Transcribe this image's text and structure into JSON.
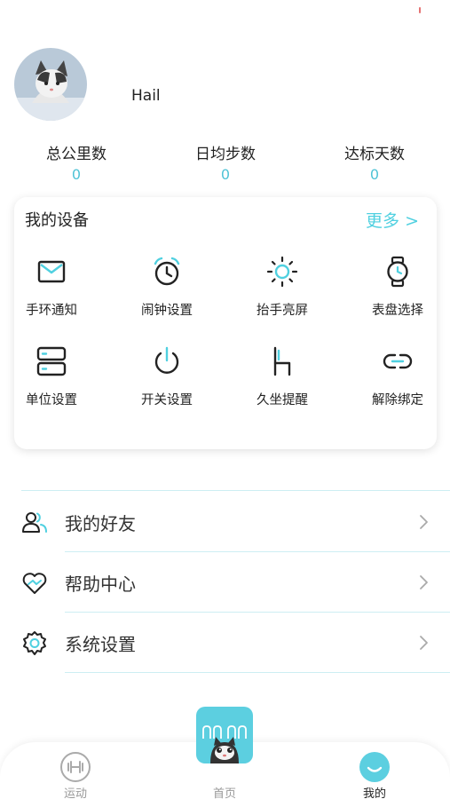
{
  "profile": {
    "name": "Hail"
  },
  "stats": [
    {
      "label": "总公里数",
      "value": "0"
    },
    {
      "label": "日均步数",
      "value": "0"
    },
    {
      "label": "达标天数",
      "value": "0"
    }
  ],
  "device": {
    "title": "我的设备",
    "more": "更多 >",
    "items": [
      {
        "label": "手环通知",
        "icon": "envelope-icon"
      },
      {
        "label": "闹钟设置",
        "icon": "alarm-clock-icon"
      },
      {
        "label": "抬手亮屏",
        "icon": "sun-icon"
      },
      {
        "label": "表盘选择",
        "icon": "watch-icon"
      },
      {
        "label": "单位设置",
        "icon": "server-icon"
      },
      {
        "label": "开关设置",
        "icon": "power-icon"
      },
      {
        "label": "久坐提醒",
        "icon": "chair-icon"
      },
      {
        "label": "解除绑定",
        "icon": "unlink-icon"
      }
    ]
  },
  "menu": [
    {
      "label": "我的好友",
      "icon": "friends-icon"
    },
    {
      "label": "帮助中心",
      "icon": "heart-hands-icon"
    },
    {
      "label": "系统设置",
      "icon": "gear-icon"
    }
  ],
  "tabbar": {
    "tabs": [
      {
        "label": "运动",
        "icon": "dumbbell-icon"
      },
      {
        "label": "首页",
        "icon": "home-cat-icon"
      },
      {
        "label": "我的",
        "icon": "smile-icon"
      }
    ],
    "active_color": "#5ccfe0"
  },
  "colors": {
    "accent": "#4fd0e0",
    "stat_value": "#4fc3d6"
  }
}
